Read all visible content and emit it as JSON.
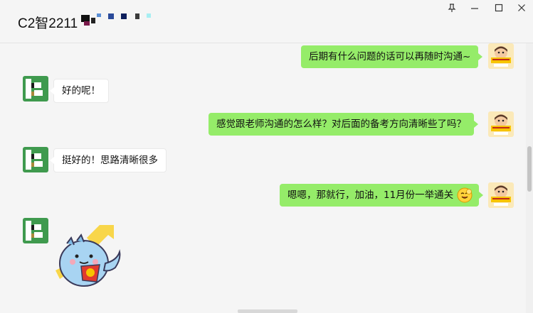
{
  "window": {
    "title": "C2智2211",
    "controls": {
      "pin": "⊥",
      "minimize": "—",
      "maximize": "☐",
      "close": "✕"
    }
  },
  "messages": [
    {
      "side": "out",
      "text": "后期有什么问题的话可以再随时沟通~"
    },
    {
      "side": "in",
      "text": "好的呢！"
    },
    {
      "side": "out",
      "text": "感觉跟老师沟通的怎么样？对后面的备考方向清晰些了吗？"
    },
    {
      "side": "in",
      "text": "挺好的！思路清晰很多"
    },
    {
      "side": "out",
      "text": "嗯嗯，那就行，加油，11月份一举通关"
    },
    {
      "side": "in",
      "type": "sticker",
      "sticker": "blue-dinosaur-cheer-sticker"
    }
  ],
  "colors": {
    "outgoing_bubble": "#95ec69",
    "incoming_bubble": "#ffffff",
    "background": "#f5f5f5",
    "avatar_green": "#3f9a4e",
    "badge_yellow": "#f7c400"
  }
}
